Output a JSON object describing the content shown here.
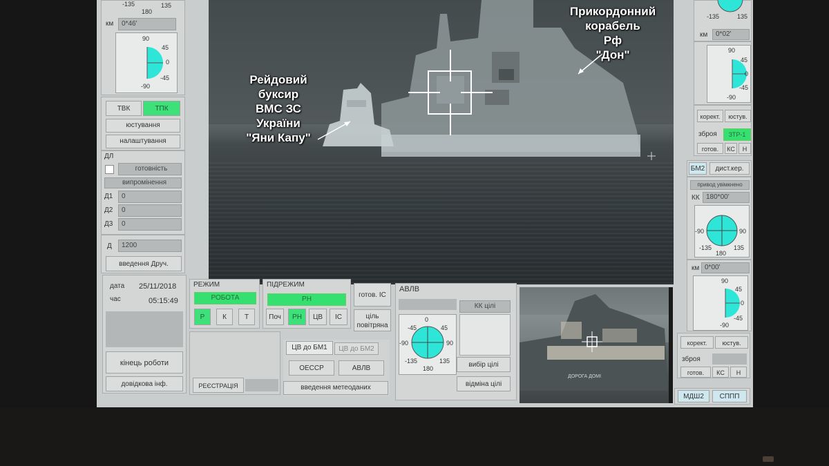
{
  "annotations": {
    "tug": [
      "Рейдовий",
      "буксир",
      "ВМС ЗС",
      "України",
      "\"Яни Капу\""
    ],
    "ship": [
      "Прикордонний",
      "корабель",
      "Рф",
      "\"Дон\""
    ]
  },
  "left": {
    "km_label": "км",
    "km_value": "0*46'",
    "dial_top": {
      "t0": "-135",
      "t1": "135",
      "t2": "180"
    },
    "dial_mid": {
      "top": "90",
      "r1": "45",
      "r0": "0",
      "r2": "-45",
      "bot": "-90"
    },
    "mode_tvk": "ТВК",
    "mode_tpk": "ТПК",
    "btn_adjust": "юстування",
    "btn_settings": "налаштування",
    "dl_label": "ДЛ",
    "readiness": "готовність",
    "emission": "випромінення",
    "d1_label": "Д1",
    "d1_value": "0",
    "d2_label": "Д2",
    "d2_value": "0",
    "d3_label": "Д3",
    "d3_value": "0",
    "d_label": "Д",
    "d_value": "1200",
    "btn_enter_d": "введення Друч."
  },
  "info": {
    "date_label": "дата",
    "date_value": "25/11/2018",
    "time_label": "час",
    "time_value": "05:15:49",
    "btn_end": "кінець роботи",
    "btn_ref": "довідкова інф."
  },
  "mode": {
    "title": "РЕЖИМ",
    "status": "РОБОТА",
    "buttons": [
      "Р",
      "К",
      "Т"
    ]
  },
  "submode": {
    "title": "ПІДРЕЖИМ",
    "status": "РН",
    "buttons": [
      "Поч",
      "РН",
      "ЦВ",
      "ІС"
    ]
  },
  "ready_is": "готов. ІС",
  "target_air": [
    "ціль",
    "повітряна"
  ],
  "registration": "РЕЄСТРАЦІЯ",
  "tabs": [
    "ЦВ до БМ1",
    "ЦВ до БМ2"
  ],
  "oessr": "ОЕССР",
  "avlv_btn": "АВЛВ",
  "meteo": "введення метеоданих",
  "avlv": {
    "title": "АВЛВ",
    "kk_targets": "КК цілі",
    "dial": {
      "top": "0",
      "tl": "-45",
      "tr": "45",
      "l": "-90",
      "r": "90",
      "bl": "-135",
      "br": "135",
      "bot": "180"
    },
    "select_target": "вибір цілі",
    "reject_target": "відміна цілі"
  },
  "right": {
    "top_dial": {
      "a": "-135",
      "b": "135"
    },
    "km_label": "км",
    "km_value": "0*02'",
    "dial1": {
      "top": "90",
      "r1": "45",
      "r0": "0",
      "r2": "-45",
      "bot": "-90"
    },
    "btn_correct": "корект.",
    "btn_adjust": "юстув.",
    "weapon_label": "зброя",
    "weapon_value": "ЗТР-1",
    "ready": "готов.",
    "ks": "КС",
    "h": "Н",
    "bm2": "БМ2",
    "remote": "дист.кер.",
    "drive": "привод увімкнено",
    "kk_label": "КК",
    "kk_value": "180*00'",
    "dial2": {
      "l": "-90",
      "r": "90",
      "bl": "-135",
      "br": "135",
      "bot": "180"
    },
    "km2_label": "км",
    "km2_value": "0*00'",
    "dial3": {
      "top": "90",
      "r1": "45",
      "r0": "0",
      "r2": "-45",
      "bot": "-90"
    },
    "btn_correct2": "корект.",
    "btn_adjust2": "юстув.",
    "weapon2_label": "зброя",
    "ready2": "готов.",
    "ks2": "КС",
    "h2": "Н",
    "mdsh2": "МДШ2",
    "sppp": "СППП"
  },
  "thumb_text": "ДОРОГА ДОМІ",
  "colors": {
    "accent_green": "#35e070",
    "cyan": "#2ee6d8"
  }
}
